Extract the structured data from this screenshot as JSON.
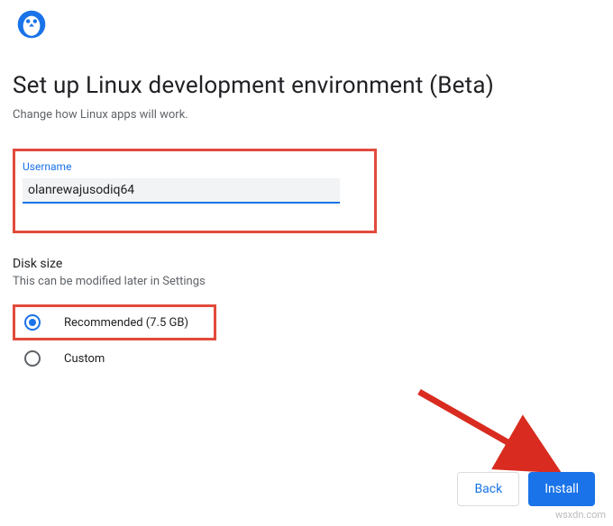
{
  "header": {
    "title": "Set up Linux development environment (Beta)",
    "subtitle": "Change how Linux apps will work."
  },
  "username": {
    "label": "Username",
    "value": "olanrewajusodiq64"
  },
  "diskSize": {
    "label": "Disk size",
    "hint": "This can be modified later in Settings",
    "options": {
      "recommended": "Recommended (7.5 GB)",
      "custom": "Custom"
    }
  },
  "footer": {
    "back": "Back",
    "install": "Install"
  },
  "watermark": "wsxdn.com"
}
